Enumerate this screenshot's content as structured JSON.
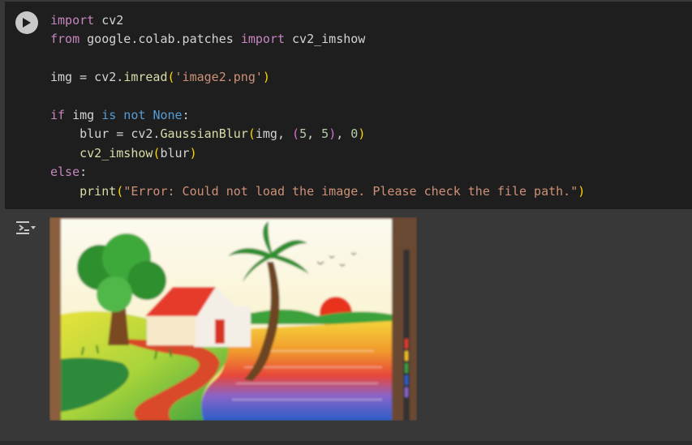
{
  "code": {
    "line1_kw": "import",
    "line1_mod": " cv2",
    "line2_kw1": "from",
    "line2_mod": " google.colab.patches ",
    "line2_kw2": "import",
    "line2_name": " cv2_imshow",
    "line4_a": "img = cv2.",
    "line4_fn": "imread",
    "line4_open": "(",
    "line4_str": "'image2.png'",
    "line4_close": ")",
    "line6_kw1": "if",
    "line6_a": " img ",
    "line6_kw2": "is not",
    "line6_sp": " ",
    "line6_none": "None",
    "line6_colon": ":",
    "line7_a": "    blur = cv2.",
    "line7_fn": "GaussianBlur",
    "line7_open": "(",
    "line7_b": "img, ",
    "line7_topen": "(",
    "line7_n1": "5",
    "line7_c1": ", ",
    "line7_n2": "5",
    "line7_tclose": ")",
    "line7_c2": ", ",
    "line7_n3": "0",
    "line7_close": ")",
    "line8_a": "    ",
    "line8_fn": "cv2_imshow",
    "line8_open": "(",
    "line8_arg": "blur",
    "line8_close": ")",
    "line9_kw": "else",
    "line9_colon": ":",
    "line10_a": "    ",
    "line10_fn": "print",
    "line10_open": "(",
    "line10_str": "\"Error: Could not load the image. Please check the file path.\"",
    "line10_close": ")"
  },
  "icons": {
    "run": "play-icon",
    "output_toggle": "output-toggle-icon"
  },
  "colors": {
    "cell_bg": "#1e1e1e",
    "page_bg": "#383838",
    "keyword": "#c586c0",
    "builtin": "#569cd6",
    "function": "#dcdcaa",
    "string": "#ce9178",
    "number": "#b5cea8"
  }
}
